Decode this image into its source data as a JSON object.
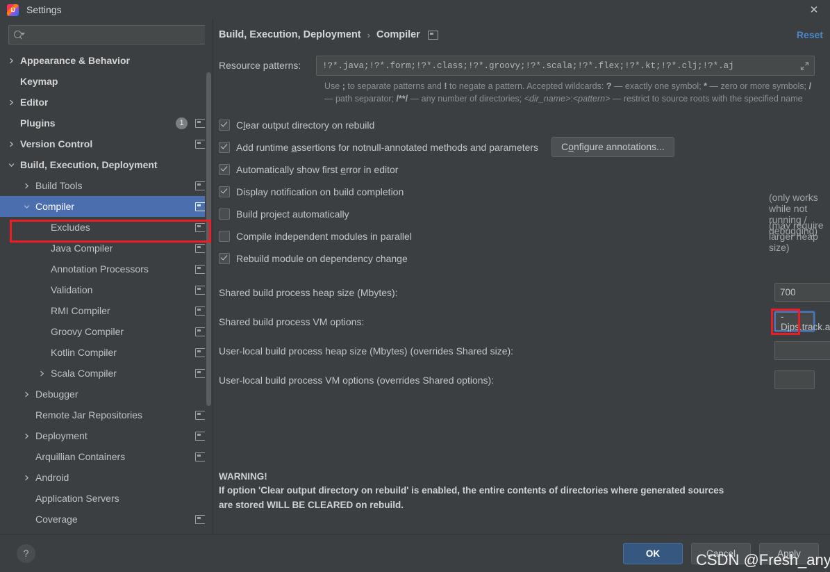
{
  "window": {
    "title": "Settings",
    "app_icon": "intellij-idea-icon",
    "close_label": "✕"
  },
  "sidebar": {
    "search": {
      "value": "",
      "placeholder": "",
      "icon": "search-icon"
    },
    "items": [
      {
        "label": "Appearance & Behavior",
        "level": 0,
        "arrow": "right",
        "bold": true,
        "cfg": false,
        "badge": null
      },
      {
        "label": "Keymap",
        "level": 0,
        "arrow": "none",
        "bold": true,
        "cfg": false,
        "badge": null
      },
      {
        "label": "Editor",
        "level": 0,
        "arrow": "right",
        "bold": true,
        "cfg": false,
        "badge": null
      },
      {
        "label": "Plugins",
        "level": 0,
        "arrow": "none",
        "bold": true,
        "cfg": true,
        "badge": "1"
      },
      {
        "label": "Version Control",
        "level": 0,
        "arrow": "right",
        "bold": true,
        "cfg": true,
        "badge": null
      },
      {
        "label": "Build, Execution, Deployment",
        "level": 0,
        "arrow": "down",
        "bold": true,
        "cfg": false,
        "badge": null
      },
      {
        "label": "Build Tools",
        "level": 1,
        "arrow": "right",
        "bold": false,
        "cfg": true,
        "badge": null
      },
      {
        "label": "Compiler",
        "level": 1,
        "arrow": "down",
        "bold": false,
        "cfg": true,
        "badge": null,
        "selected": true
      },
      {
        "label": "Excludes",
        "level": 2,
        "arrow": "none",
        "bold": false,
        "cfg": true,
        "badge": null
      },
      {
        "label": "Java Compiler",
        "level": 2,
        "arrow": "none",
        "bold": false,
        "cfg": true,
        "badge": null
      },
      {
        "label": "Annotation Processors",
        "level": 2,
        "arrow": "none",
        "bold": false,
        "cfg": true,
        "badge": null
      },
      {
        "label": "Validation",
        "level": 2,
        "arrow": "none",
        "bold": false,
        "cfg": true,
        "badge": null
      },
      {
        "label": "RMI Compiler",
        "level": 2,
        "arrow": "none",
        "bold": false,
        "cfg": true,
        "badge": null
      },
      {
        "label": "Groovy Compiler",
        "level": 2,
        "arrow": "none",
        "bold": false,
        "cfg": true,
        "badge": null
      },
      {
        "label": "Kotlin Compiler",
        "level": 2,
        "arrow": "none",
        "bold": false,
        "cfg": true,
        "badge": null
      },
      {
        "label": "Scala Compiler",
        "level": 2,
        "arrow": "right",
        "bold": false,
        "cfg": true,
        "badge": null
      },
      {
        "label": "Debugger",
        "level": 1,
        "arrow": "right",
        "bold": false,
        "cfg": false,
        "badge": null
      },
      {
        "label": "Remote Jar Repositories",
        "level": 1,
        "arrow": "none",
        "bold": false,
        "cfg": true,
        "badge": null
      },
      {
        "label": "Deployment",
        "level": 1,
        "arrow": "right",
        "bold": false,
        "cfg": true,
        "badge": null
      },
      {
        "label": "Arquillian Containers",
        "level": 1,
        "arrow": "none",
        "bold": false,
        "cfg": true,
        "badge": null
      },
      {
        "label": "Android",
        "level": 1,
        "arrow": "right",
        "bold": false,
        "cfg": false,
        "badge": null
      },
      {
        "label": "Application Servers",
        "level": 1,
        "arrow": "none",
        "bold": false,
        "cfg": false,
        "badge": null
      },
      {
        "label": "Coverage",
        "level": 1,
        "arrow": "none",
        "bold": false,
        "cfg": true,
        "badge": null
      }
    ]
  },
  "main": {
    "breadcrumb": {
      "parent": "Build, Execution, Deployment",
      "separator": "›",
      "current": "Compiler",
      "config_icon": "project-settings-icon"
    },
    "reset_label": "Reset",
    "resource_patterns": {
      "label": "Resource patterns:",
      "value": "!?*.java;!?*.form;!?*.class;!?*.groovy;!?*.scala;!?*.flex;!?*.kt;!?*.clj;!?*.aj",
      "expand_icon": "expand-icon"
    },
    "hint": {
      "line1_a": "Use ",
      "line1_semi": ";",
      "line1_b": " to separate patterns and ",
      "line1_bang": "!",
      "line1_c": " to negate a pattern. Accepted wildcards: ",
      "line1_q": "?",
      "line1_d": " — exactly one symbol; ",
      "line1_star": "*",
      "line1_e": " — zero or more symbols; ",
      "line2_slash": "/",
      "line2_a": " — path separator; ",
      "line2_globs": "/**/",
      "line2_b": " — any number of directories; ",
      "line2_dir": "<dir_name>",
      "line2_colon": ":",
      "line2_pattern": "<pattern>",
      "line2_c": " — restrict to source roots with the specified name"
    },
    "checkboxes": [
      {
        "checked": true,
        "pre": "C",
        "mnemonic": "l",
        "post": "ear output directory on rebuild",
        "note": null,
        "button": null
      },
      {
        "checked": true,
        "pre": "Add runtime ",
        "mnemonic": "a",
        "post": "ssertions for notnull-annotated methods and parameters",
        "note": null,
        "button": {
          "pre": "C",
          "mnemonic": "o",
          "post": "nfigure annotations..."
        }
      },
      {
        "checked": true,
        "pre": "Automatically show first ",
        "mnemonic": "e",
        "post": "rror in editor",
        "note": null,
        "button": null
      },
      {
        "checked": true,
        "pre": "Display notification on build completion",
        "mnemonic": "",
        "post": "",
        "note": null,
        "button": null
      },
      {
        "checked": false,
        "pre": "Build project automatically",
        "mnemonic": "",
        "post": "",
        "note": "(only works while not running / debugging)",
        "button": null
      },
      {
        "checked": false,
        "pre": "Compile independent modules in parallel",
        "mnemonic": "",
        "post": "",
        "note": "(may require larger heap size)",
        "button": null
      },
      {
        "checked": true,
        "pre": "Rebuild module on dependency change",
        "mnemonic": "",
        "post": "",
        "note": null,
        "button": null
      }
    ],
    "fields": [
      {
        "label": "Shared build process heap size (Mbytes):",
        "value": "700",
        "kind": "number",
        "focused": false
      },
      {
        "label": "Shared build process VM options:",
        "value": "-Djps.track.ap.dependencies=false",
        "kind": "text",
        "focused": true,
        "highlighted": true
      },
      {
        "label": "User-local build process heap size (Mbytes) (overrides Shared size):",
        "value": "",
        "kind": "number",
        "focused": false
      },
      {
        "label": "User-local build process VM options (overrides Shared options):",
        "value": "",
        "kind": "text",
        "focused": false
      }
    ],
    "warning": {
      "title": "WARNING!",
      "line1": "If option 'Clear output directory on rebuild' is enabled, the entire contents of directories where generated sources",
      "line2": "are stored WILL BE CLEARED on rebuild."
    }
  },
  "footer": {
    "help_label": "?",
    "ok_label": "OK",
    "cancel_label": "Cancel",
    "apply_label": "Apply"
  },
  "watermark": "CSDN @Fresh_anyu",
  "colors": {
    "background": "#3c3f41",
    "selection_blue": "#4b6eaf",
    "accent_link": "#4a88c7",
    "annotation_red": "#ee1c25",
    "focus_blue": "#4b78b5",
    "primary_button": "#365880"
  }
}
